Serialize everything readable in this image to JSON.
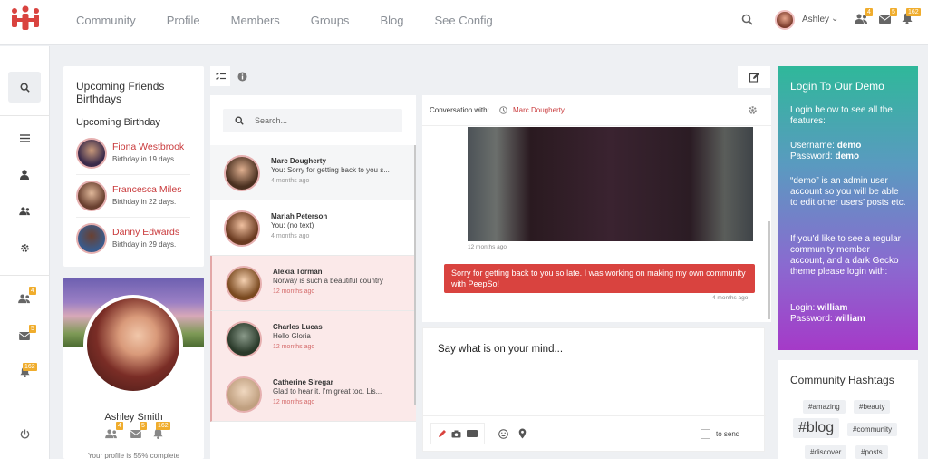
{
  "nav": [
    "Community",
    "Profile",
    "Members",
    "Groups",
    "Blog",
    "See Config"
  ],
  "user": {
    "name": "Ashley"
  },
  "badges": {
    "friends": "4",
    "messages": "5",
    "notifications": "162"
  },
  "birthdays": {
    "title": "Upcoming Friends Birthdays",
    "subtitle": "Upcoming Birthday",
    "items": [
      {
        "name": "Fiona Westbrook",
        "when": "Birthday in 19 days."
      },
      {
        "name": "Francesca Miles",
        "when": "Birthday in 22 days."
      },
      {
        "name": "Danny Edwards",
        "when": "Birthday in 29 days."
      }
    ]
  },
  "profile": {
    "name": "Ashley Smith",
    "complete": "Your profile is 55% complete"
  },
  "search": {
    "placeholder": "Search..."
  },
  "conversations": [
    {
      "name": "Marc Dougherty",
      "message": "You: Sorry for getting back to you s...",
      "time": "4 months ago"
    },
    {
      "name": "Mariah Peterson",
      "message": "You: (no text)",
      "time": "4 months ago"
    },
    {
      "name": "Alexia Torman",
      "message": "Norway is such a beautiful country",
      "time": "12 months ago"
    },
    {
      "name": "Charles Lucas",
      "message": "Hello Gloria",
      "time": "12 months ago"
    },
    {
      "name": "Catherine Siregar",
      "message": "Glad to hear it. I'm great too. Lis...",
      "time": "12 months ago"
    }
  ],
  "chat": {
    "label": "Conversation with:",
    "with": "Marc Dougherty",
    "image_time": "12 months ago",
    "message": "Sorry for getting back to you so late. I was working on making my own community with PeepSo!",
    "message_time": "4 months ago"
  },
  "composer": {
    "placeholder": "Say what is on your mind...",
    "send_label": "to send"
  },
  "login": {
    "title": "Login To Our Demo",
    "intro": "Login below to see all the features:",
    "username_label": "Username:",
    "username": "demo",
    "password_label": "Password:",
    "password": "demo",
    "admin_note": "“demo” is an admin user account so you will be able to edit other users’ posts etc.",
    "regular_note": "If you'd like to see a regular community member account, and a dark Gecko theme please login with:",
    "login_label": "Login:",
    "login": "william",
    "password2_label": "Password:",
    "password2": "william"
  },
  "hashtags": {
    "title": "Community Hashtags",
    "tags": [
      "#amazing",
      "#beauty",
      "#blog",
      "#community",
      "#discover",
      "#posts"
    ]
  },
  "colors": {
    "accent": "#d9433f",
    "badge": "#f0ad2d"
  },
  "icons": [
    "logo-icon",
    "search-icon",
    "menu-icon",
    "user-icon",
    "group-icon",
    "gear-icon",
    "friends-icon",
    "mail-icon",
    "bell-icon",
    "power-icon",
    "edit-icon",
    "info-icon",
    "checklist-icon",
    "clock-icon",
    "pencil-icon",
    "camera-icon",
    "gif-icon",
    "smile-icon",
    "pin-icon"
  ]
}
